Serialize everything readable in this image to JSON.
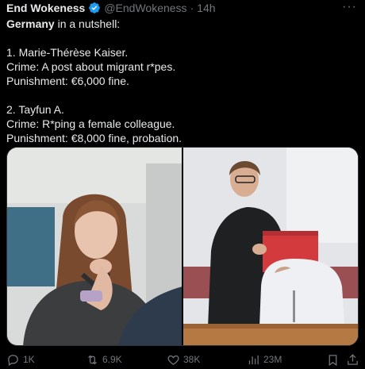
{
  "header": {
    "display_name": "End Wokeness",
    "handle": "@EndWokeness",
    "separator": "·",
    "time": "14h",
    "more": "···"
  },
  "tweet": {
    "line1_bold": "Germany",
    "line1_rest": " in a nutshell:",
    "case1": {
      "name": "1. Marie-Thérèse Kaiser.",
      "crime": "Crime: A post about migrant r*pes.",
      "punishment": "Punishment: €6,000 fine."
    },
    "case2": {
      "name": "2. Tayfun A.",
      "crime": "Crime: R*ping a female colleague.",
      "punishment": "Punishment: €8,000 fine, probation."
    }
  },
  "actions": {
    "replies": "1K",
    "reposts": "6.9K",
    "likes": "38K",
    "views": "23M"
  },
  "colors": {
    "verified": "#1d9bf0",
    "muted": "#71767b",
    "text": "#e7e9ea",
    "background": "#000000"
  }
}
